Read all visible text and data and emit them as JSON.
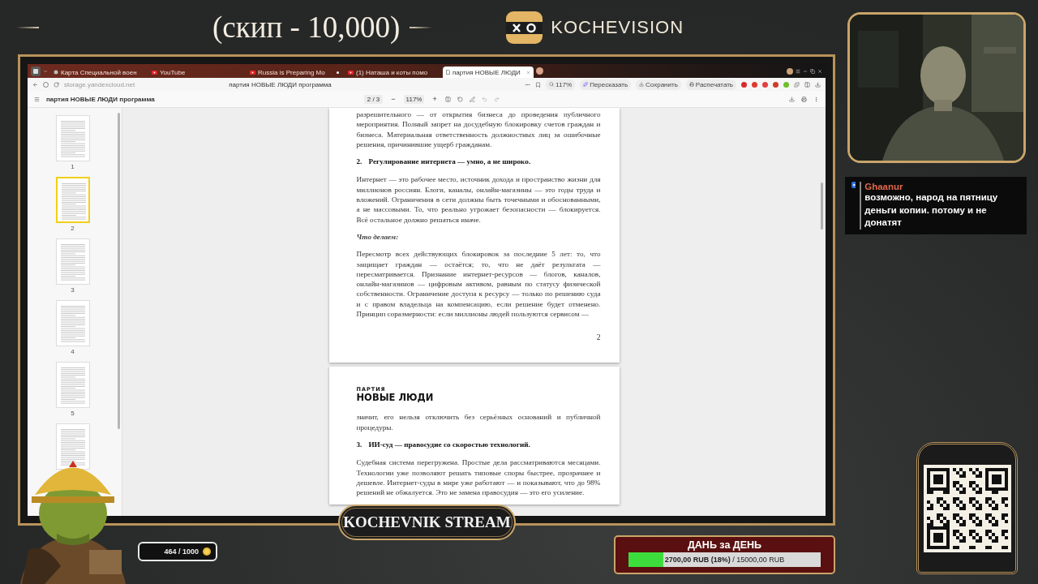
{
  "header": {
    "title": "(скип - 10,000)",
    "brand": "KOCHEVISION"
  },
  "browser": {
    "tabs": [
      {
        "label": "Карта Специальной воен",
        "kind": "site",
        "selected": false,
        "indicator": false
      },
      {
        "label": "YouTube",
        "kind": "video",
        "selected": false,
        "indicator": false
      },
      {
        "label": "Russia is Preparing Mo",
        "kind": "video",
        "selected": false,
        "indicator": true
      },
      {
        "label": "(1) Наташа и коты помо",
        "kind": "video",
        "selected": false,
        "indicator": false
      },
      {
        "label": "партия НОВЫЕ ЛЮДИ",
        "kind": "document",
        "selected": true,
        "indicator": false
      }
    ],
    "address": "storage.yandexcloud.net",
    "page_title": "партия НОВЫЕ ЛЮДИ программа",
    "zoom": "117%",
    "actions": [
      "Пересказать",
      "Сохранить",
      "Распечатать"
    ]
  },
  "pdf_viewer": {
    "title": "партия НОВЫЕ ЛЮДИ программа",
    "page_indicator": "2 / 3",
    "zoom_out": "−",
    "zoom": "117%",
    "zoom_in": "+",
    "thumbnails": [
      {
        "label": "1",
        "selected": false
      },
      {
        "label": "2",
        "selected": true
      },
      {
        "label": "3",
        "selected": false
      },
      {
        "label": "4",
        "selected": false
      },
      {
        "label": "5",
        "selected": false
      },
      {
        "selected": false
      }
    ],
    "pages": [
      {
        "blocks": [
          {
            "kind": "paragraph",
            "text": "разрешительного — от открытия бизнеса до проведения публичного мероприятия. Полный запрет на досудебную блокировку счетов граждан и бизнеса. Материальная ответственность должностных лиц за ошибочные решения, причинившие ущерб гражданам."
          },
          {
            "kind": "heading",
            "number": "2.",
            "text": "Регулирование интернета — умно, а не широко."
          },
          {
            "kind": "paragraph",
            "text": "Интернет — это рабочее место, источник дохода и пространство жизни для миллионов россиян. Блоги, каналы, онлайн-магазины — это годы труда и вложений. Ограничения в сети должны быть точечными и обоснованными, а не массовыми. То, что реально угрожает безопасности — блокируется. Всё остальное должно решаться иначе."
          },
          {
            "kind": "subheading",
            "text": "Что делаем:"
          },
          {
            "kind": "paragraph",
            "text": "Пересмотр всех действующих блокировок за последние 5 лет: то, что защищает граждан — остаётся; то, что не даёт результата — пересматривается. Признание интернет-ресурсов — блогов, каналов, онлайн-магазинов — цифровым активом, равным по статусу физической собственности. Ограничение доступа к ресурсу — только по решению суда и с правом владельца на компенсацию, если решение будет отменено. Принцип соразмерности: если миллионы людей пользуются сервисом —"
          }
        ],
        "page_number": "2"
      },
      {
        "logo": {
          "small": "ПАРТИЯ",
          "big": "НОВЫЕ ЛЮДИ"
        },
        "blocks": [
          {
            "kind": "paragraph",
            "text": "значит, его нельзя отключить без серьёзных оснований и публичной процедуры."
          },
          {
            "kind": "heading",
            "number": "3.",
            "text": "ИИ-суд — правосудие со скоростью технологий."
          },
          {
            "kind": "paragraph",
            "text": "Судебная система перегружена. Простые дела рассматриваются месяцами. Технологии уже позволяют решать типовые споры быстрее, прозрачнее и дешевле. Интернет-суды в мире уже работают — и показывают, что до 98% решений не обжалуется. Это не замена правосудия — это его усиление."
          }
        ]
      }
    ]
  },
  "chat": {
    "user": "Ghaanur",
    "message": "возможно, народ на пятницу деньги копии. потому и не донатят"
  },
  "points": "464 / 1000",
  "stream_badge": "KOCHEVNIK STREAM",
  "donation": {
    "title": "ДАНЬ за ДЕНЬ",
    "level": 0.18,
    "reading": "**2700,00 RUB (18%)** / 15000,00 RUB"
  }
}
